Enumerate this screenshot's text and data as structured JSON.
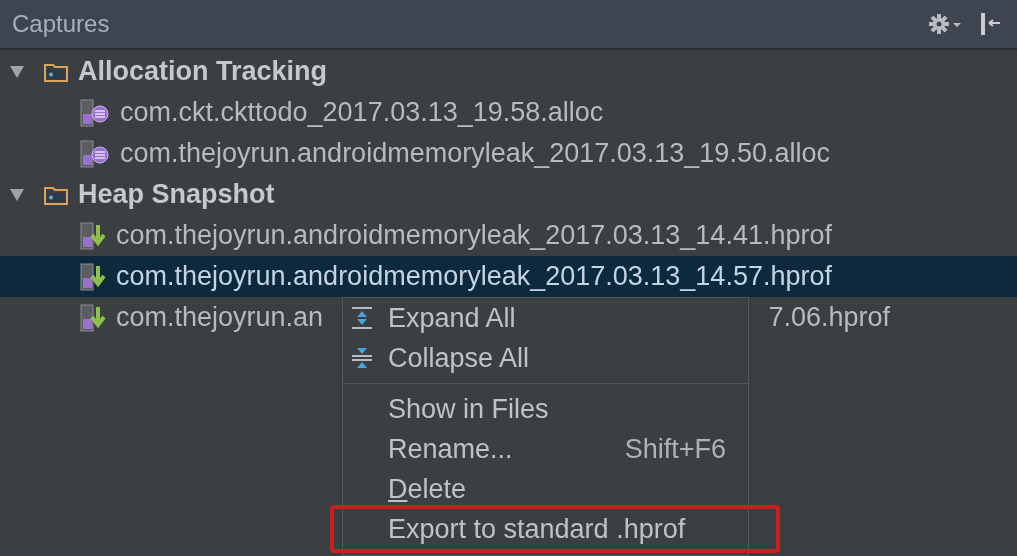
{
  "panel": {
    "title": "Captures"
  },
  "tree": [
    {
      "label": "Allocation Tracking",
      "kind": "group",
      "expanded": true,
      "children": [
        {
          "label": "com.ckt.ckttodo_2017.03.13_19.58.alloc",
          "kind": "alloc",
          "selected": false
        },
        {
          "label": "com.thejoyrun.androidmemoryleak_2017.03.13_19.50.alloc",
          "kind": "alloc",
          "selected": false
        }
      ]
    },
    {
      "label": "Heap Snapshot",
      "kind": "group",
      "expanded": true,
      "children": [
        {
          "label": "com.thejoyrun.androidmemoryleak_2017.03.13_14.41.hprof",
          "kind": "hprof",
          "selected": false
        },
        {
          "label": "com.thejoyrun.androidmemoryleak_2017.03.13_14.57.hprof",
          "kind": "hprof",
          "selected": true
        },
        {
          "label": "com.thejoyrun.an",
          "label_end": "7.06.hprof",
          "kind": "hprof",
          "selected": false
        }
      ]
    }
  ],
  "context_menu": {
    "items": [
      {
        "kind": "expand",
        "label": "Expand All"
      },
      {
        "kind": "collapse",
        "label": "Collapse All"
      },
      {
        "kind": "separator"
      },
      {
        "kind": "plain",
        "label": "Show in Files"
      },
      {
        "kind": "plain",
        "label": "Rename...",
        "shortcut": "Shift+F6"
      },
      {
        "kind": "plain",
        "label": "Delete",
        "mnemonic_underlined": true
      },
      {
        "kind": "plain",
        "label": "Export to standard .hprof",
        "annotated": true
      }
    ]
  }
}
